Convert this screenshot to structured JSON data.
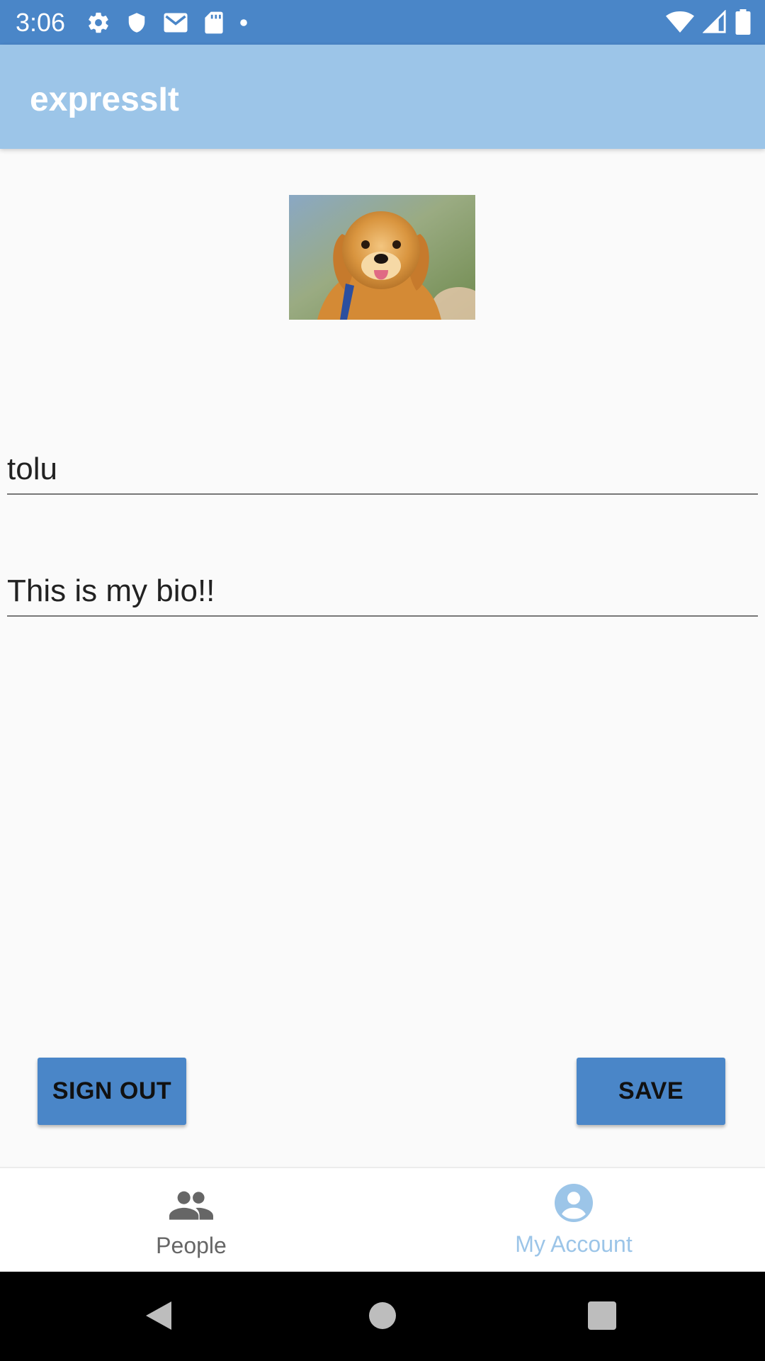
{
  "status_bar": {
    "time": "3:06",
    "icons": [
      "gear-icon",
      "shield-icon",
      "gmail-icon",
      "sd-card-icon",
      "dot-icon",
      "wifi-icon",
      "signal-icon",
      "battery-icon"
    ]
  },
  "app_bar": {
    "title": "expressIt",
    "color": "#9cc5e8"
  },
  "profile": {
    "username": "tolu",
    "bio": "This is my bio!!"
  },
  "buttons": {
    "sign_out": "SIGN OUT",
    "save": "SAVE",
    "color": "#4a86c8"
  },
  "bottom_nav": {
    "items": [
      {
        "label": "People",
        "icon": "people-icon",
        "selected": false
      },
      {
        "label": "My Account",
        "icon": "account-circle-icon",
        "selected": true
      }
    ]
  },
  "system_nav": {
    "icons": [
      "back-icon",
      "home-icon",
      "recents-icon"
    ]
  }
}
